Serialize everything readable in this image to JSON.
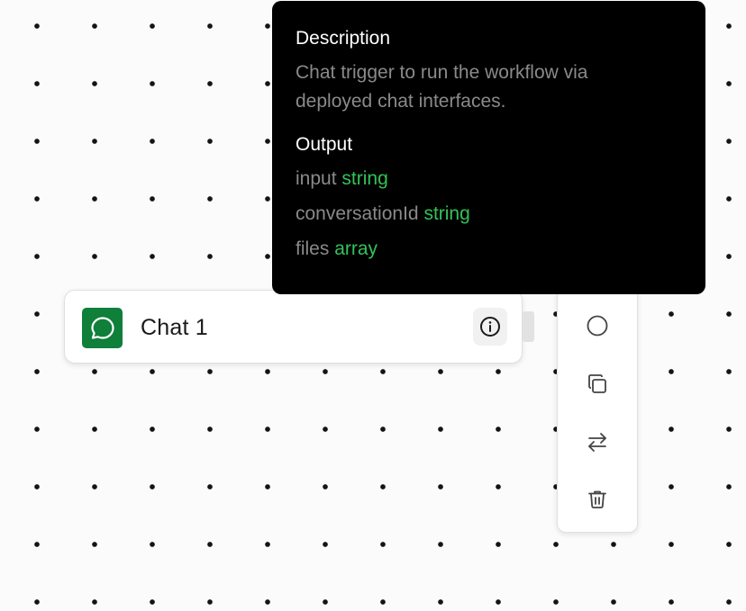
{
  "node": {
    "title": "Chat 1",
    "icon": "chat-bubble-icon",
    "icon_bg": "#0f7f3a"
  },
  "tooltip": {
    "description_heading": "Description",
    "description": "Chat trigger to run the workflow via deployed chat interfaces.",
    "output_heading": "Output",
    "fields": [
      {
        "name": "input",
        "type": "string"
      },
      {
        "name": "conversationId",
        "type": "string"
      },
      {
        "name": "files",
        "type": "array"
      }
    ],
    "type_color": "#33c258"
  },
  "toolbar": {
    "buttons": [
      "toggle-circle-icon",
      "duplicate-icon",
      "swap-arrows-icon",
      "trash-icon"
    ]
  }
}
